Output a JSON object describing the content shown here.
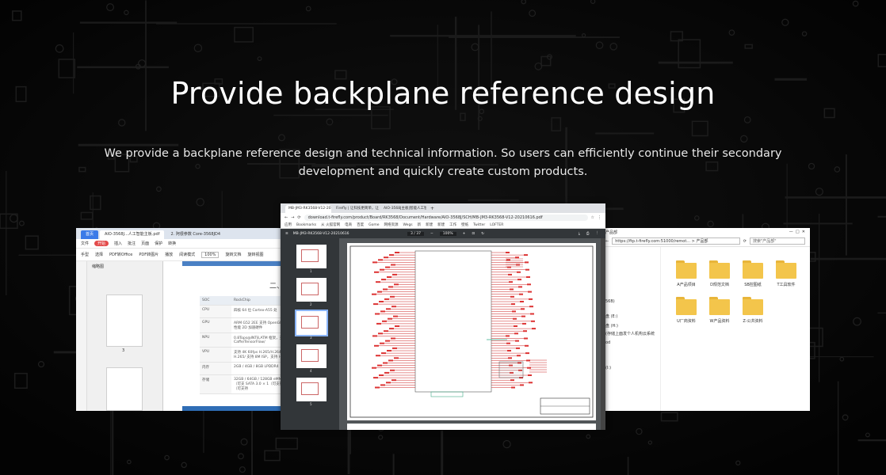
{
  "hero": {
    "title": "Provide backplane reference design",
    "subtitle": "We provide a backplane reference design and technical information. So users can efficiently continue their secondary development and quickly create custom products."
  },
  "left_window": {
    "tabs": [
      "首页",
      "AIO-3568J...人工智能主板.pdf",
      "2. 阿很参数 Core-3568JD4"
    ],
    "menu": [
      "文件",
      "开始",
      "插入",
      "批注",
      "页面",
      "保护",
      "转换"
    ],
    "menu_highlight": "开始",
    "toolbar": [
      "手型",
      "选择",
      "PDF转Office",
      "PDF转图片",
      "播放",
      "阅读模式",
      "旋转文档",
      "旋转视图"
    ],
    "zoom": "100%",
    "thumbnail_header": "缩略图",
    "page_number": "3",
    "doc_heading": "二、",
    "table": [
      [
        "SOC",
        "RockChip"
      ],
      [
        "CPU",
        "四核 64 位 Cortex-A55 处"
      ],
      [
        "GPU",
        "ARM G52 2EE 支持 OpenGL ES 1.1/2.0 内嵌高性能 2D 加速硬件"
      ],
      [
        "NPU",
        "0.8Tops@INT8,ATM 框架，支持 Caffe/TensorFlow/"
      ],
      [
        "VPU",
        "支持 4K 60fps H.265/H.264 支持 1080P 100fps H.265/ 支持 8M ISP，支持 HDR"
      ],
      [
        "内存",
        "2GB / 4GB / 8GB LPDDR4"
      ],
      [
        "存储",
        "32GB / 64GB / 128GB eMMC M.2 PCIe 3.0 × 1（可支 SATA 3.0 × 1（可支持 TF-Card Slot × 1（可支持"
      ]
    ]
  },
  "center_window": {
    "tabs": [
      "MB-JM3-RK3568-V12-2021...",
      "Firefly | 让科技更简单，让生活...",
      "AIO-3568J主板|智能人工智能主..."
    ],
    "url": "download.t-firefly.com/product/Board/RK3568/Document/Hardware/AIO-3568J/SCH/MB-JM3-RK3568-V12-20210616.pdf",
    "bookmarks": [
      "应用",
      "Bookmarks",
      "从 火狐官网",
      "电商",
      "百度",
      "Gome",
      "网络资源",
      "Wegs",
      "新",
      "新建",
      "新建",
      "工作",
      "壁纸",
      "Twitter",
      "LOFTER"
    ],
    "pdf_title": "MB-JM3-RK3568-V12-20210616",
    "page_indicator": "3 / 37",
    "zoom": "100%",
    "thumbnail_pages": [
      "1",
      "2",
      "3",
      "4",
      "5"
    ]
  },
  "right_window": {
    "title": "产品部",
    "address": "https://ftp.t-firefly.com:51000/remot... > 产品部",
    "search_placeholder": "搜索\"产品部\"",
    "nav_items": [
      "56B)",
      "盘 (E:)",
      "盘 (H:)",
      "(存储上面发个人机构云系统",
      "od",
      "(I:)"
    ],
    "folders": [
      "A产品项目",
      "D规范文档",
      "SB控图纸",
      "T工具软件",
      "U厂商资料",
      "W产品资料",
      "Z-公共资料"
    ]
  },
  "colors": {
    "background": "#0a0a0a",
    "accent_blue": "#3b7be8",
    "folder": "#f3c54b"
  }
}
